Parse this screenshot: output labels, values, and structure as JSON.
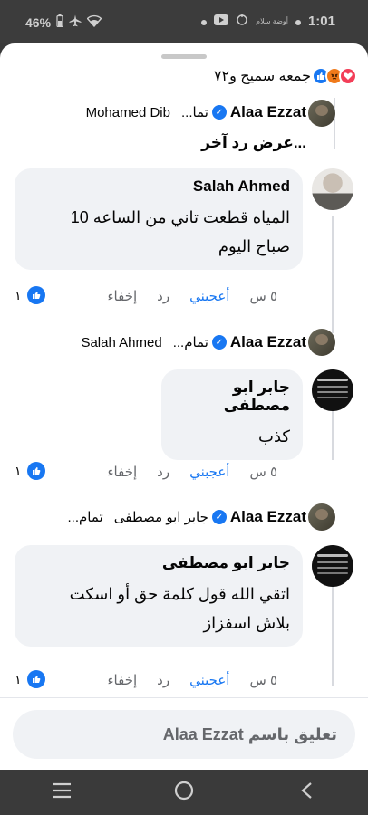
{
  "status_bar": {
    "battery": "46%",
    "time": "1:01",
    "mini_text": "أوضة سلام"
  },
  "reactions": {
    "names": "جمعه سميح و٧٢",
    "icons": [
      "like-icon",
      "angry-icon",
      "love-icon"
    ]
  },
  "preview1": {
    "name": "Alaa Ezzat",
    "text": "تما...",
    "mention": "Mohamed Dib"
  },
  "more_replies": "عرض رد آخر...",
  "comment1": {
    "name": "Salah Ahmed",
    "text_line1": "المياه قطعت تاني من الساعه 10",
    "text_line2": "صباح اليوم",
    "time": "٥ س",
    "like": "أعجبني",
    "reply": "رد",
    "hide": "إخفاء",
    "likes": "١"
  },
  "preview2": {
    "name": "Alaa Ezzat",
    "text": "تمام...",
    "mention": "Salah Ahmed"
  },
  "comment2": {
    "name": "جابر ابو مصطفى",
    "text_line1": "كذب",
    "time": "٥ س",
    "like": "أعجبني",
    "reply": "رد",
    "hide": "إخفاء",
    "likes": "١"
  },
  "preview3": {
    "name": "Alaa Ezzat",
    "mention": "جابر ابو مصطفى",
    "text": "تمام..."
  },
  "comment3": {
    "name": "جابر ابو مصطفى",
    "text_line1": "اتقي الله قول كلمة حق أو اسكت",
    "text_line2": "بلاش اسفزاز",
    "time": "٥ س",
    "like": "أعجبني",
    "reply": "رد",
    "hide": "إخفاء",
    "likes": "١"
  },
  "composer": {
    "placeholder": "تعليق باسم Alaa Ezzat"
  },
  "colors": {
    "accent": "#1877f2",
    "bubble": "#f0f2f5",
    "muted": "#65676b"
  }
}
